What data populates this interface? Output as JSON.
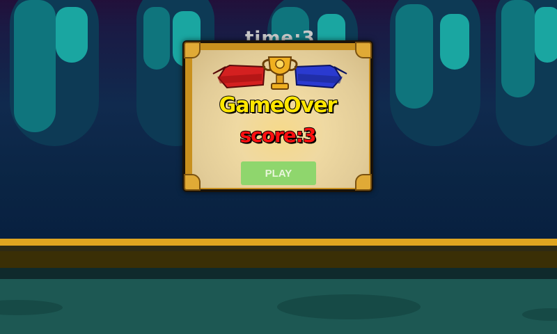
{
  "hud": {
    "timer_text": "time:3"
  },
  "dialog": {
    "title": "GameOver",
    "score_text": "score:3",
    "play_label": "PLAY",
    "trophy_icon": "trophy-icon"
  },
  "colors": {
    "title": "#ffe600",
    "score": "#ff1010",
    "play_button": "#8fd66d",
    "banner_left": "#d42020",
    "banner_right": "#2a3ad0"
  }
}
